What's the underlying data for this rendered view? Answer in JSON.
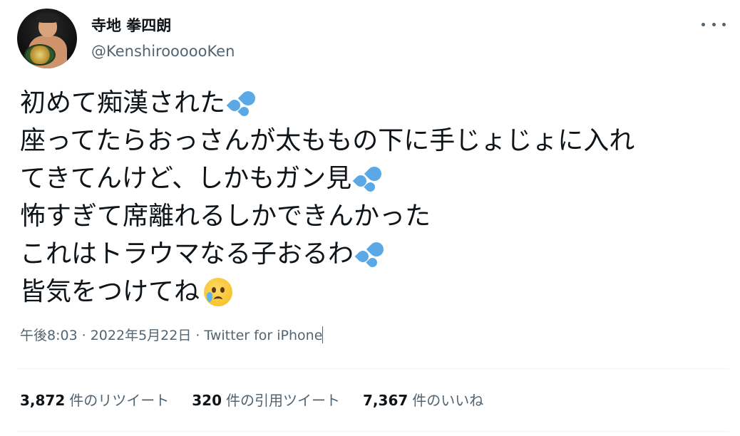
{
  "user": {
    "name": "寺地 拳四朗",
    "handle": "@KenshiroooooKen"
  },
  "tweet": {
    "lines": [
      "初めて痴漢された",
      "座ってたらおっさんが太ももの下に手じょじょに入れ",
      "てきてんけど、しかもガン見",
      "怖すぎて席離れるしかできんかった",
      "これはトラウマなる子おるわ",
      "皆気をつけてね"
    ],
    "emoji": {
      "line_0": "sweat-droplets-icon",
      "line_2": "sweat-droplets-icon",
      "line_4": "sweat-droplets-icon",
      "line_5": "crying-face-icon"
    }
  },
  "meta": {
    "time": "午後8:03",
    "separator": "·",
    "date": "2022年5月22日",
    "source": "Twitter for iPhone"
  },
  "stats": [
    {
      "count": "3,872",
      "label": "件のリツイート"
    },
    {
      "count": "320",
      "label": "件の引用ツイート"
    },
    {
      "count": "7,367",
      "label": "件のいいね"
    }
  ],
  "colors": {
    "text": "#0f1419",
    "secondary": "#536471",
    "divider": "#eff3f4",
    "sweat": "#5aa9e6"
  }
}
